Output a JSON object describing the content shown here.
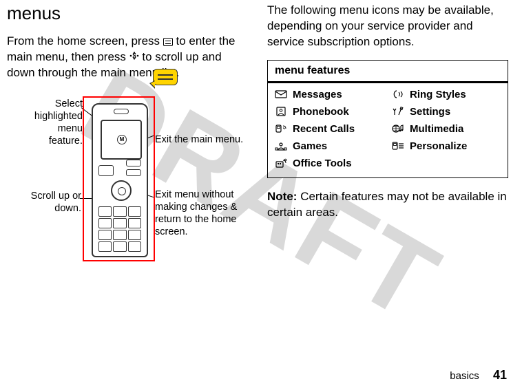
{
  "heading": "menus",
  "left_para": {
    "p1a": "From the home screen, press ",
    "p1b": " to enter the main menu, then press ",
    "s_glyph": "•Ṡ•",
    "p1c": " to scroll up and down through the main menu list."
  },
  "callouts": {
    "select": "Select highlighted menu feature.",
    "scroll": "Scroll up or down.",
    "exit_main": "Exit the main menu.",
    "exit_home": "Exit menu without making changes & return to the home screen."
  },
  "right_para": "The following menu icons may be available, depending on your service provider and service subscription options.",
  "menu_table": {
    "header": "menu features",
    "rows": [
      [
        {
          "icon": "messages-icon",
          "label": "Messages"
        },
        {
          "icon": "ring-styles-icon",
          "label": "Ring Styles"
        }
      ],
      [
        {
          "icon": "phonebook-icon",
          "label": "Phonebook"
        },
        {
          "icon": "settings-icon",
          "label": "Settings"
        }
      ],
      [
        {
          "icon": "recent-calls-icon",
          "label": "Recent Calls"
        },
        {
          "icon": "multimedia-icon",
          "label": "Multimedia"
        }
      ],
      [
        {
          "icon": "games-icon",
          "label": "Games"
        },
        {
          "icon": "personalize-icon",
          "label": "Personalize"
        }
      ],
      [
        {
          "icon": "office-tools-icon",
          "label": "Office Tools"
        }
      ]
    ]
  },
  "note": {
    "label": "Note:",
    "text": " Certain features may not be available in certain areas."
  },
  "footer": {
    "section": "basics",
    "page": "41"
  }
}
